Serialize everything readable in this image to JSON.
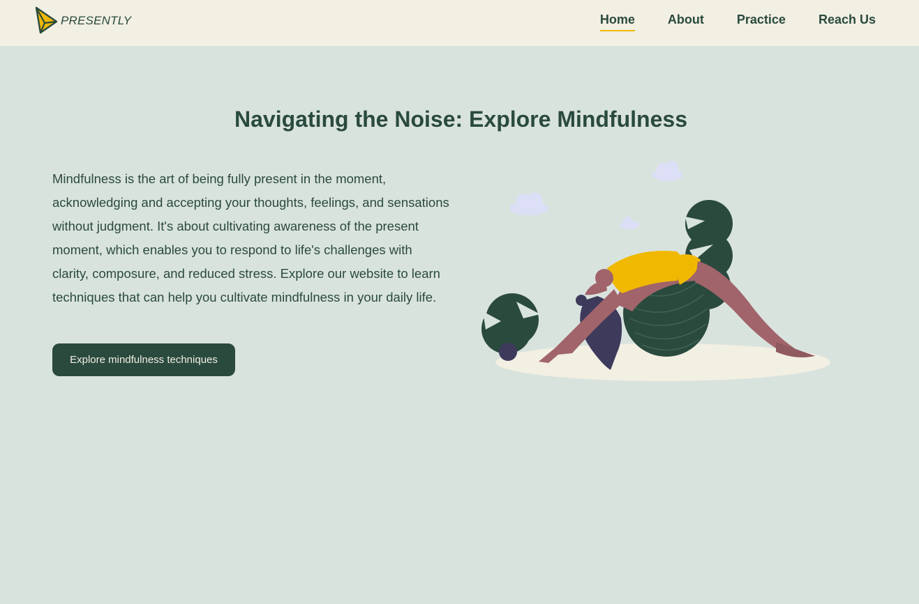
{
  "brand": {
    "name": "PRESENTLY"
  },
  "nav": {
    "items": [
      {
        "label": "Home",
        "active": true
      },
      {
        "label": "About",
        "active": false
      },
      {
        "label": "Practice",
        "active": false
      },
      {
        "label": "Reach Us",
        "active": false
      }
    ]
  },
  "hero": {
    "title": "Navigating the Noise: Explore Mindfulness",
    "description": "Mindfulness is the art of being fully present in the moment, acknowledging and accepting your thoughts, feelings, and sensations without judgment. It's about cultivating awareness of the present moment, which enables you to respond to life's challenges with clarity, composure, and reduced stress. Explore our website to learn techniques that can help you cultivate mindfulness in your daily life.",
    "cta_label": "Explore mindfulness techniques"
  },
  "colors": {
    "background": "#d9e3de",
    "navbar": "#f2efe3",
    "primary": "#2a4a3e",
    "accent": "#f0b800"
  },
  "icons": {
    "logo": "paper-plane-logo-icon"
  }
}
